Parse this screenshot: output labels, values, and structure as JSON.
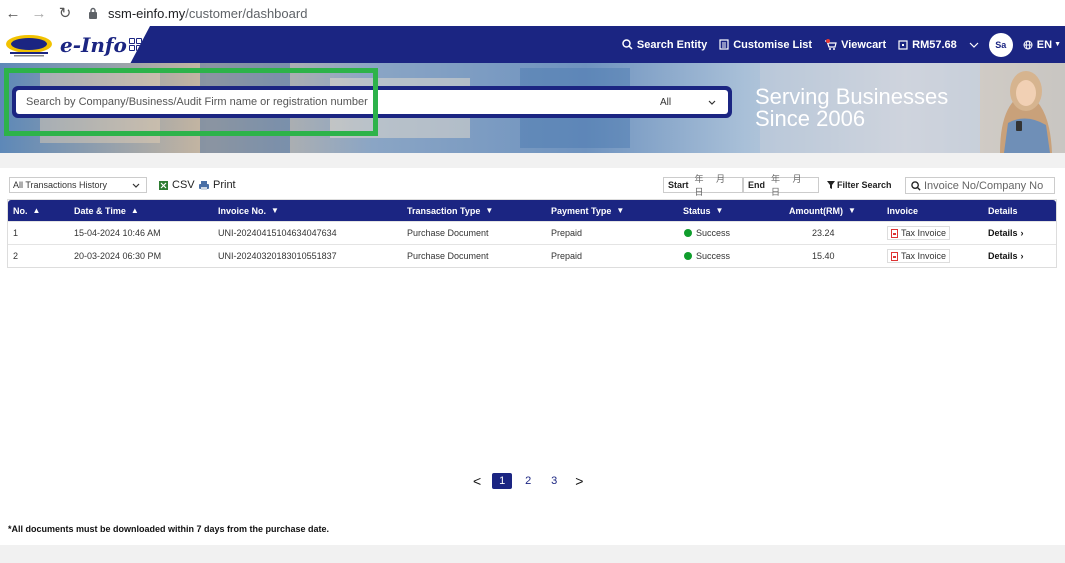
{
  "browser": {
    "url_host": "ssm-einfo.my",
    "url_path": "/customer/dashboard"
  },
  "header": {
    "brand": "e-Info",
    "nav": [
      {
        "label": "Search Entity",
        "icon": "search-icon"
      },
      {
        "label": "Customise List",
        "icon": "list-icon"
      },
      {
        "label": "Viewcart",
        "icon": "cart-icon"
      },
      {
        "label": "RM57.68",
        "icon": "wallet-icon"
      }
    ],
    "avatar": "Sa",
    "lang": "EN"
  },
  "banner": {
    "search_placeholder": "Search by Company/Business/Audit Firm name or registration number",
    "scope": "All",
    "tagline_1": "Serving Businesses",
    "tagline_2": "Since 2006"
  },
  "toolbar": {
    "history_filter": "All Transactions History",
    "csv": "CSV",
    "print": "Print",
    "start_label": "Start",
    "end_label": "End",
    "date_placeholder": "年 月 日",
    "filter_search": "Filter Search",
    "invoice_placeholder": "Invoice No/Company No"
  },
  "table": {
    "columns": [
      "No.",
      "Date & Time",
      "Invoice No.",
      "Transaction Type",
      "Payment Type",
      "Status",
      "Amount(RM)",
      "Invoice",
      "Details"
    ],
    "rows": [
      {
        "no": "1",
        "datetime": "15-04-2024 10:46 AM",
        "invoice_no": "UNI-20240415104634047634",
        "type": "Purchase Document",
        "payment": "Prepaid",
        "status": "Success",
        "amount": "23.24",
        "invoice": "Tax Invoice",
        "details": "Details"
      },
      {
        "no": "2",
        "datetime": "20-03-2024 06:30 PM",
        "invoice_no": "UNI-20240320183010551837",
        "type": "Purchase Document",
        "payment": "Prepaid",
        "status": "Success",
        "amount": "15.40",
        "invoice": "Tax Invoice",
        "details": "Details"
      }
    ]
  },
  "pagination": {
    "prev": "<",
    "pages": [
      "1",
      "2",
      "3"
    ],
    "next": ">"
  },
  "footer_note": "*All documents must be downloaded within 7 days from the purchase date.",
  "colors": {
    "brand": "#1b2582",
    "highlight": "#2db34a",
    "success": "#0f9d2c"
  }
}
